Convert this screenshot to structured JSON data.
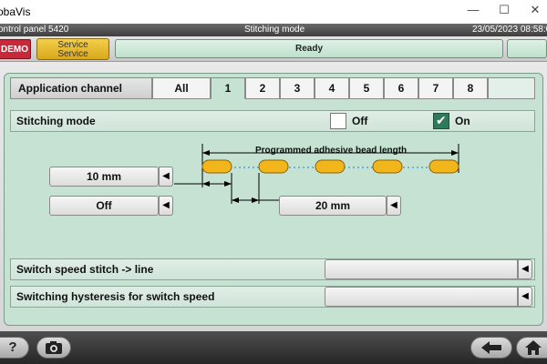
{
  "window": {
    "title": "obaVis",
    "minimize": "—",
    "maximize": "☐",
    "close": "✕"
  },
  "infobar": {
    "left": "ontrol panel 5420",
    "center": "Stitching mode",
    "right": "23/05/2023 08:58:0"
  },
  "status": {
    "demo": "DEMO",
    "service_line1": "Service",
    "service_line2": "Service",
    "ready": "Ready"
  },
  "tabs": {
    "header": "Application channel",
    "items": [
      "All",
      "1",
      "2",
      "3",
      "4",
      "5",
      "6",
      "7",
      "8"
    ],
    "active": "1"
  },
  "stitching": {
    "label": "Stitching mode",
    "off_label": "Off",
    "on_label": "On",
    "selected": "On"
  },
  "diagram": {
    "title": "Programmed adhesive bead length",
    "bead_length": "10 mm",
    "gap_setting": "Off",
    "gap_length": "20 mm",
    "bead_color": "#f2b51b"
  },
  "switch_speed": {
    "label": "Switch speed stitch -> line",
    "value": ""
  },
  "hysteresis": {
    "label": "Switching hysteresis for switch speed",
    "value": ""
  },
  "toolbar": {
    "help": "?",
    "camera_icon": "camera-icon",
    "back_icon": "back-arrow-icon",
    "home_icon": "home-icon"
  },
  "arrow_glyph": "◀"
}
